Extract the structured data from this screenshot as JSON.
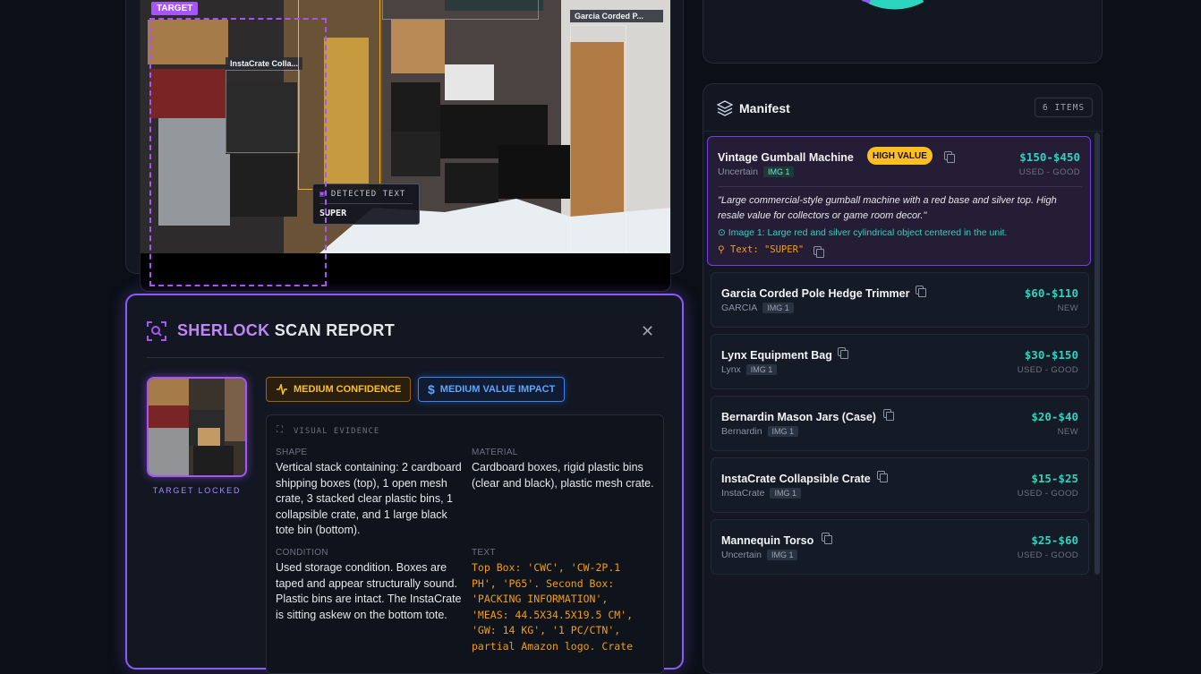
{
  "viewer": {
    "target_tag": "TARGET",
    "detections": [
      {
        "label": "InstaCrate Colla..."
      },
      {
        "label": "Garcia Corded P..."
      }
    ],
    "detected_text": {
      "heading": "DETECTED TEXT",
      "value": "SUPER"
    }
  },
  "report": {
    "title_accent": "SHERLOCK",
    "title_rest": "SCAN REPORT",
    "target_locked": "TARGET LOCKED",
    "confidence_label": "MEDIUM CONFIDENCE",
    "impact_label": "MEDIUM VALUE IMPACT",
    "evidence": {
      "heading": "VISUAL EVIDENCE",
      "shape_label": "SHAPE",
      "shape": "Vertical stack containing: 2 cardboard shipping boxes (top), 1 open mesh crate, 3 stacked clear plastic bins, 1 collapsible crate, and 1 large black tote bin (bottom).",
      "material_label": "MATERIAL",
      "material": "Cardboard boxes, rigid plastic bins (clear and black), plastic mesh crate.",
      "condition_label": "CONDITION",
      "condition": "Used storage condition. Boxes are taped and appear structurally sound. Plastic bins are intact. The InstaCrate is sitting askew on the bottom tote.",
      "text_label": "TEXT",
      "text": "Top Box: 'CWC', 'CW-2P.1 PH', 'P65'. Second Box: 'PACKING INFORMATION', 'MEAS: 44.5X34.5X19.5 CM', 'GW: 14 KG', '1 PC/CTN', partial Amazon logo. Crate"
    }
  },
  "manifest": {
    "title": "Manifest",
    "count": "6 ITEMS",
    "items": [
      {
        "name": "Vintage Gumball Machine",
        "brand": "Uncertain",
        "img": "IMG 1",
        "price": "$150-$450",
        "condition": "USED - GOOD",
        "badge": "HIGH VALUE",
        "quote": "\"Large commercial-style gumball machine with a red base and silver top. High resale value for collectors or game room decor.\"",
        "image_note": "Image 1: Large red and silver cylindrical object centered in the unit.",
        "text_note": "Text: \"SUPER\""
      },
      {
        "name": "Garcia Corded Pole Hedge Trimmer",
        "brand": "GARCIA",
        "img": "IMG 1",
        "price": "$60-$110",
        "condition": "NEW"
      },
      {
        "name": "Lynx Equipment Bag",
        "brand": "Lynx",
        "img": "IMG 1",
        "price": "$30-$150",
        "condition": "USED - GOOD"
      },
      {
        "name": "Bernardin Mason Jars (Case)",
        "brand": "Bernardin",
        "img": "IMG 1",
        "price": "$20-$40",
        "condition": "NEW"
      },
      {
        "name": "InstaCrate Collapsible Crate",
        "brand": "InstaCrate",
        "img": "IMG 1",
        "price": "$15-$25",
        "condition": "USED - GOOD"
      },
      {
        "name": "Mannequin Torso",
        "brand": "Uncertain",
        "img": "IMG 1",
        "price": "$25-$60",
        "condition": "USED - GOOD"
      }
    ]
  },
  "colors": {
    "accent": "#a855f7",
    "price": "#2dd4bf",
    "warning": "#fbbf24",
    "info": "#3b82f6"
  }
}
